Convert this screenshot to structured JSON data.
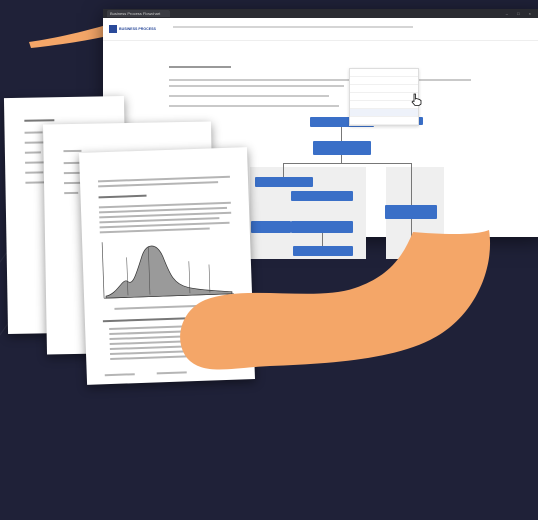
{
  "browser": {
    "tab_title": "Business Process Flowchart",
    "window_controls": "– □ ×",
    "logo_text": "BUSINESS PROCESS",
    "nav_links": [
      "",
      "",
      "",
      "",
      "",
      "",
      "",
      "",
      "",
      "",
      ""
    ],
    "dropdown_items": [
      "",
      "",
      "",
      "",
      "",
      "",
      ""
    ],
    "active_dropdown_index": 5
  },
  "colors": {
    "background": "#1f2138",
    "accent_orange": "#f4a668",
    "node_blue": "#3a6fc7"
  },
  "icons": [
    "hand-pointer-icon"
  ]
}
